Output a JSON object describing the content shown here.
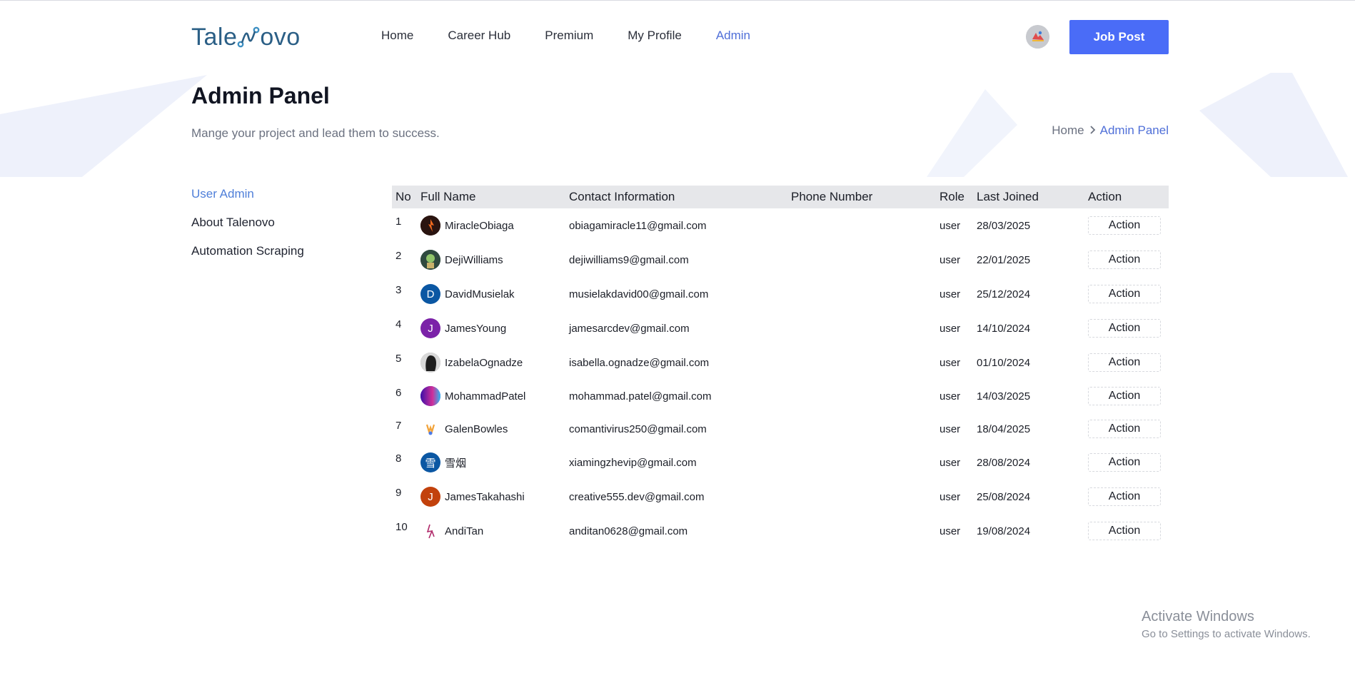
{
  "brand": {
    "name_left": "Tale",
    "name_right": "ovo"
  },
  "nav": [
    {
      "label": "Home",
      "active": false
    },
    {
      "label": "Career Hub",
      "active": false
    },
    {
      "label": "Premium",
      "active": false
    },
    {
      "label": "My Profile",
      "active": false
    },
    {
      "label": "Admin",
      "active": true
    }
  ],
  "header": {
    "job_post_label": "Job Post"
  },
  "hero": {
    "title": "Admin Panel",
    "subtitle": "Mange your project and lead them to success.",
    "breadcrumb": {
      "home": "Home",
      "current": "Admin Panel"
    }
  },
  "sidebar": {
    "items": [
      {
        "label": "User Admin",
        "active": true
      },
      {
        "label": "About Talenovo",
        "active": false
      },
      {
        "label": "Automation Scraping",
        "active": false
      }
    ]
  },
  "table": {
    "columns": [
      "No",
      "Full Name",
      "Contact Information",
      "Phone Number",
      "Role",
      "Last Joined",
      "Action"
    ],
    "rows": [
      {
        "no": "1",
        "name": "MiracleObiaga",
        "email": "obiagamiracle11@gmail.com",
        "phone": "",
        "role": "user",
        "joined": "28/03/2025",
        "action": "Action",
        "avatar_letter": "",
        "avatar_color": "#3a1f1a"
      },
      {
        "no": "2",
        "name": "DejiWilliams",
        "email": "dejiwilliams9@gmail.com",
        "phone": "",
        "role": "user",
        "joined": "22/01/2025",
        "action": "Action",
        "avatar_letter": "",
        "avatar_color": "#3d5a4a"
      },
      {
        "no": "3",
        "name": "DavidMusielak",
        "email": "musielakdavid00@gmail.com",
        "phone": "",
        "role": "user",
        "joined": "25/12/2024",
        "action": "Action",
        "avatar_letter": "D",
        "avatar_color": "#0b57a3"
      },
      {
        "no": "4",
        "name": "JamesYoung",
        "email": "jamesarcdev@gmail.com",
        "phone": "",
        "role": "user",
        "joined": "14/10/2024",
        "action": "Action",
        "avatar_letter": "J",
        "avatar_color": "#7b22a8"
      },
      {
        "no": "5",
        "name": "IzabelaOgnadze",
        "email": "isabella.ognadze@gmail.com",
        "phone": "",
        "role": "user",
        "joined": "01/10/2024",
        "action": "Action",
        "avatar_letter": "",
        "avatar_color": "#9a9a9a"
      },
      {
        "no": "6",
        "name": "MohammadPatel",
        "email": "mohammad.patel@gmail.com",
        "phone": "",
        "role": "user",
        "joined": "14/03/2025",
        "action": "Action",
        "avatar_letter": "",
        "avatar_color": "#4b1fd6"
      },
      {
        "no": "7",
        "name": "GalenBowles",
        "email": "comantivirus250@gmail.com",
        "phone": "",
        "role": "user",
        "joined": "18/04/2025",
        "action": "Action",
        "avatar_letter": "",
        "avatar_color": "#ffffff"
      },
      {
        "no": "8",
        "name": "雪烟",
        "email": "xiamingzhevip@gmail.com",
        "phone": "",
        "role": "user",
        "joined": "28/08/2024",
        "action": "Action",
        "avatar_letter": "雪",
        "avatar_color": "#0b57a3"
      },
      {
        "no": "9",
        "name": "JamesTakahashi",
        "email": "creative555.dev@gmail.com",
        "phone": "",
        "role": "user",
        "joined": "25/08/2024",
        "action": "Action",
        "avatar_letter": "J",
        "avatar_color": "#c2410c"
      },
      {
        "no": "10",
        "name": "AndiTan",
        "email": "anditan0628@gmail.com",
        "phone": "",
        "role": "user",
        "joined": "19/08/2024",
        "action": "Action",
        "avatar_letter": "",
        "avatar_color": "#ffffff"
      }
    ]
  },
  "watermark": {
    "line1": "Activate Windows",
    "line2": "Go to Settings to activate Windows."
  },
  "colors": {
    "accent": "#4a6cf7",
    "link_active": "#4f6fd8",
    "table_header_bg": "#e6e7ea",
    "hero_shape": "#eef1fb"
  }
}
